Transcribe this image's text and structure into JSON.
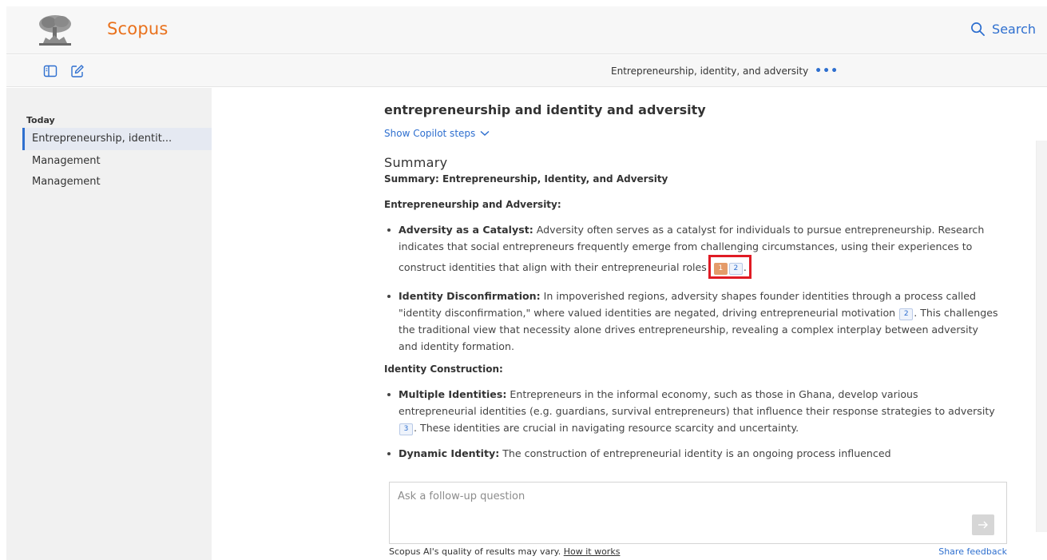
{
  "header": {
    "brand": "Scopus",
    "search_label": "Search"
  },
  "toolbar": {
    "conversation_title": "Entrepreneurship, identity, and adversity",
    "more_label": "•••"
  },
  "sidebar": {
    "heading": "Today",
    "items": [
      {
        "label": "Entrepreneurship, identit..."
      },
      {
        "label": "Management"
      },
      {
        "label": "Management"
      }
    ]
  },
  "main": {
    "query": "entrepreneurship and identity and adversity",
    "show_steps": "Show Copilot steps",
    "summary_heading": "Summary",
    "summary_subheading": "Summary: Entrepreneurship, Identity, and Adversity",
    "section1": {
      "heading": "Entrepreneurship and Adversity:",
      "bullets": [
        {
          "title": "Adversity as a Catalyst:",
          "text": " Adversity often serves as a catalyst for individuals to pursue entrepreneurship. Research indicates that social entrepreneurs frequently emerge from challenging circumstances, using their experiences to construct identities that align with their entrepreneurial roles",
          "cites": [
            "1",
            "2"
          ],
          "after": "."
        },
        {
          "title": "Identity Disconfirmation:",
          "text": " In impoverished regions, adversity shapes founder identities through a process called \"identity disconfirmation,\" where valued identities are negated, driving entrepreneurial motivation",
          "cites": [
            "2"
          ],
          "after": ". This challenges the traditional view that necessity alone drives entrepreneurship, revealing a complex interplay between adversity and identity formation."
        }
      ]
    },
    "section2": {
      "heading": "Identity Construction:",
      "bullets": [
        {
          "title": "Multiple Identities:",
          "text": " Entrepreneurs in the informal economy, such as those in Ghana, develop various entrepreneurial identities (e.g. guardians, survival entrepreneurs) that influence their response strategies to adversity",
          "cites": [
            "3"
          ],
          "after": ". These identities are crucial in navigating resource scarcity and uncertainty."
        },
        {
          "title": "Dynamic Identity:",
          "text": " The construction of entrepreneurial identity is an ongoing process influenced",
          "cites": [],
          "after": ""
        }
      ]
    },
    "followup_placeholder": "Ask a follow-up question",
    "footer_note": "Scopus AI's quality of results may vary.",
    "how_it_works": "How it works",
    "share_feedback": "Share feedback"
  },
  "colors": {
    "brand": "#e9711c",
    "link": "#2e6fcf",
    "highlight_cite": "#e49b6a",
    "annotation_box": "#e01b24"
  }
}
